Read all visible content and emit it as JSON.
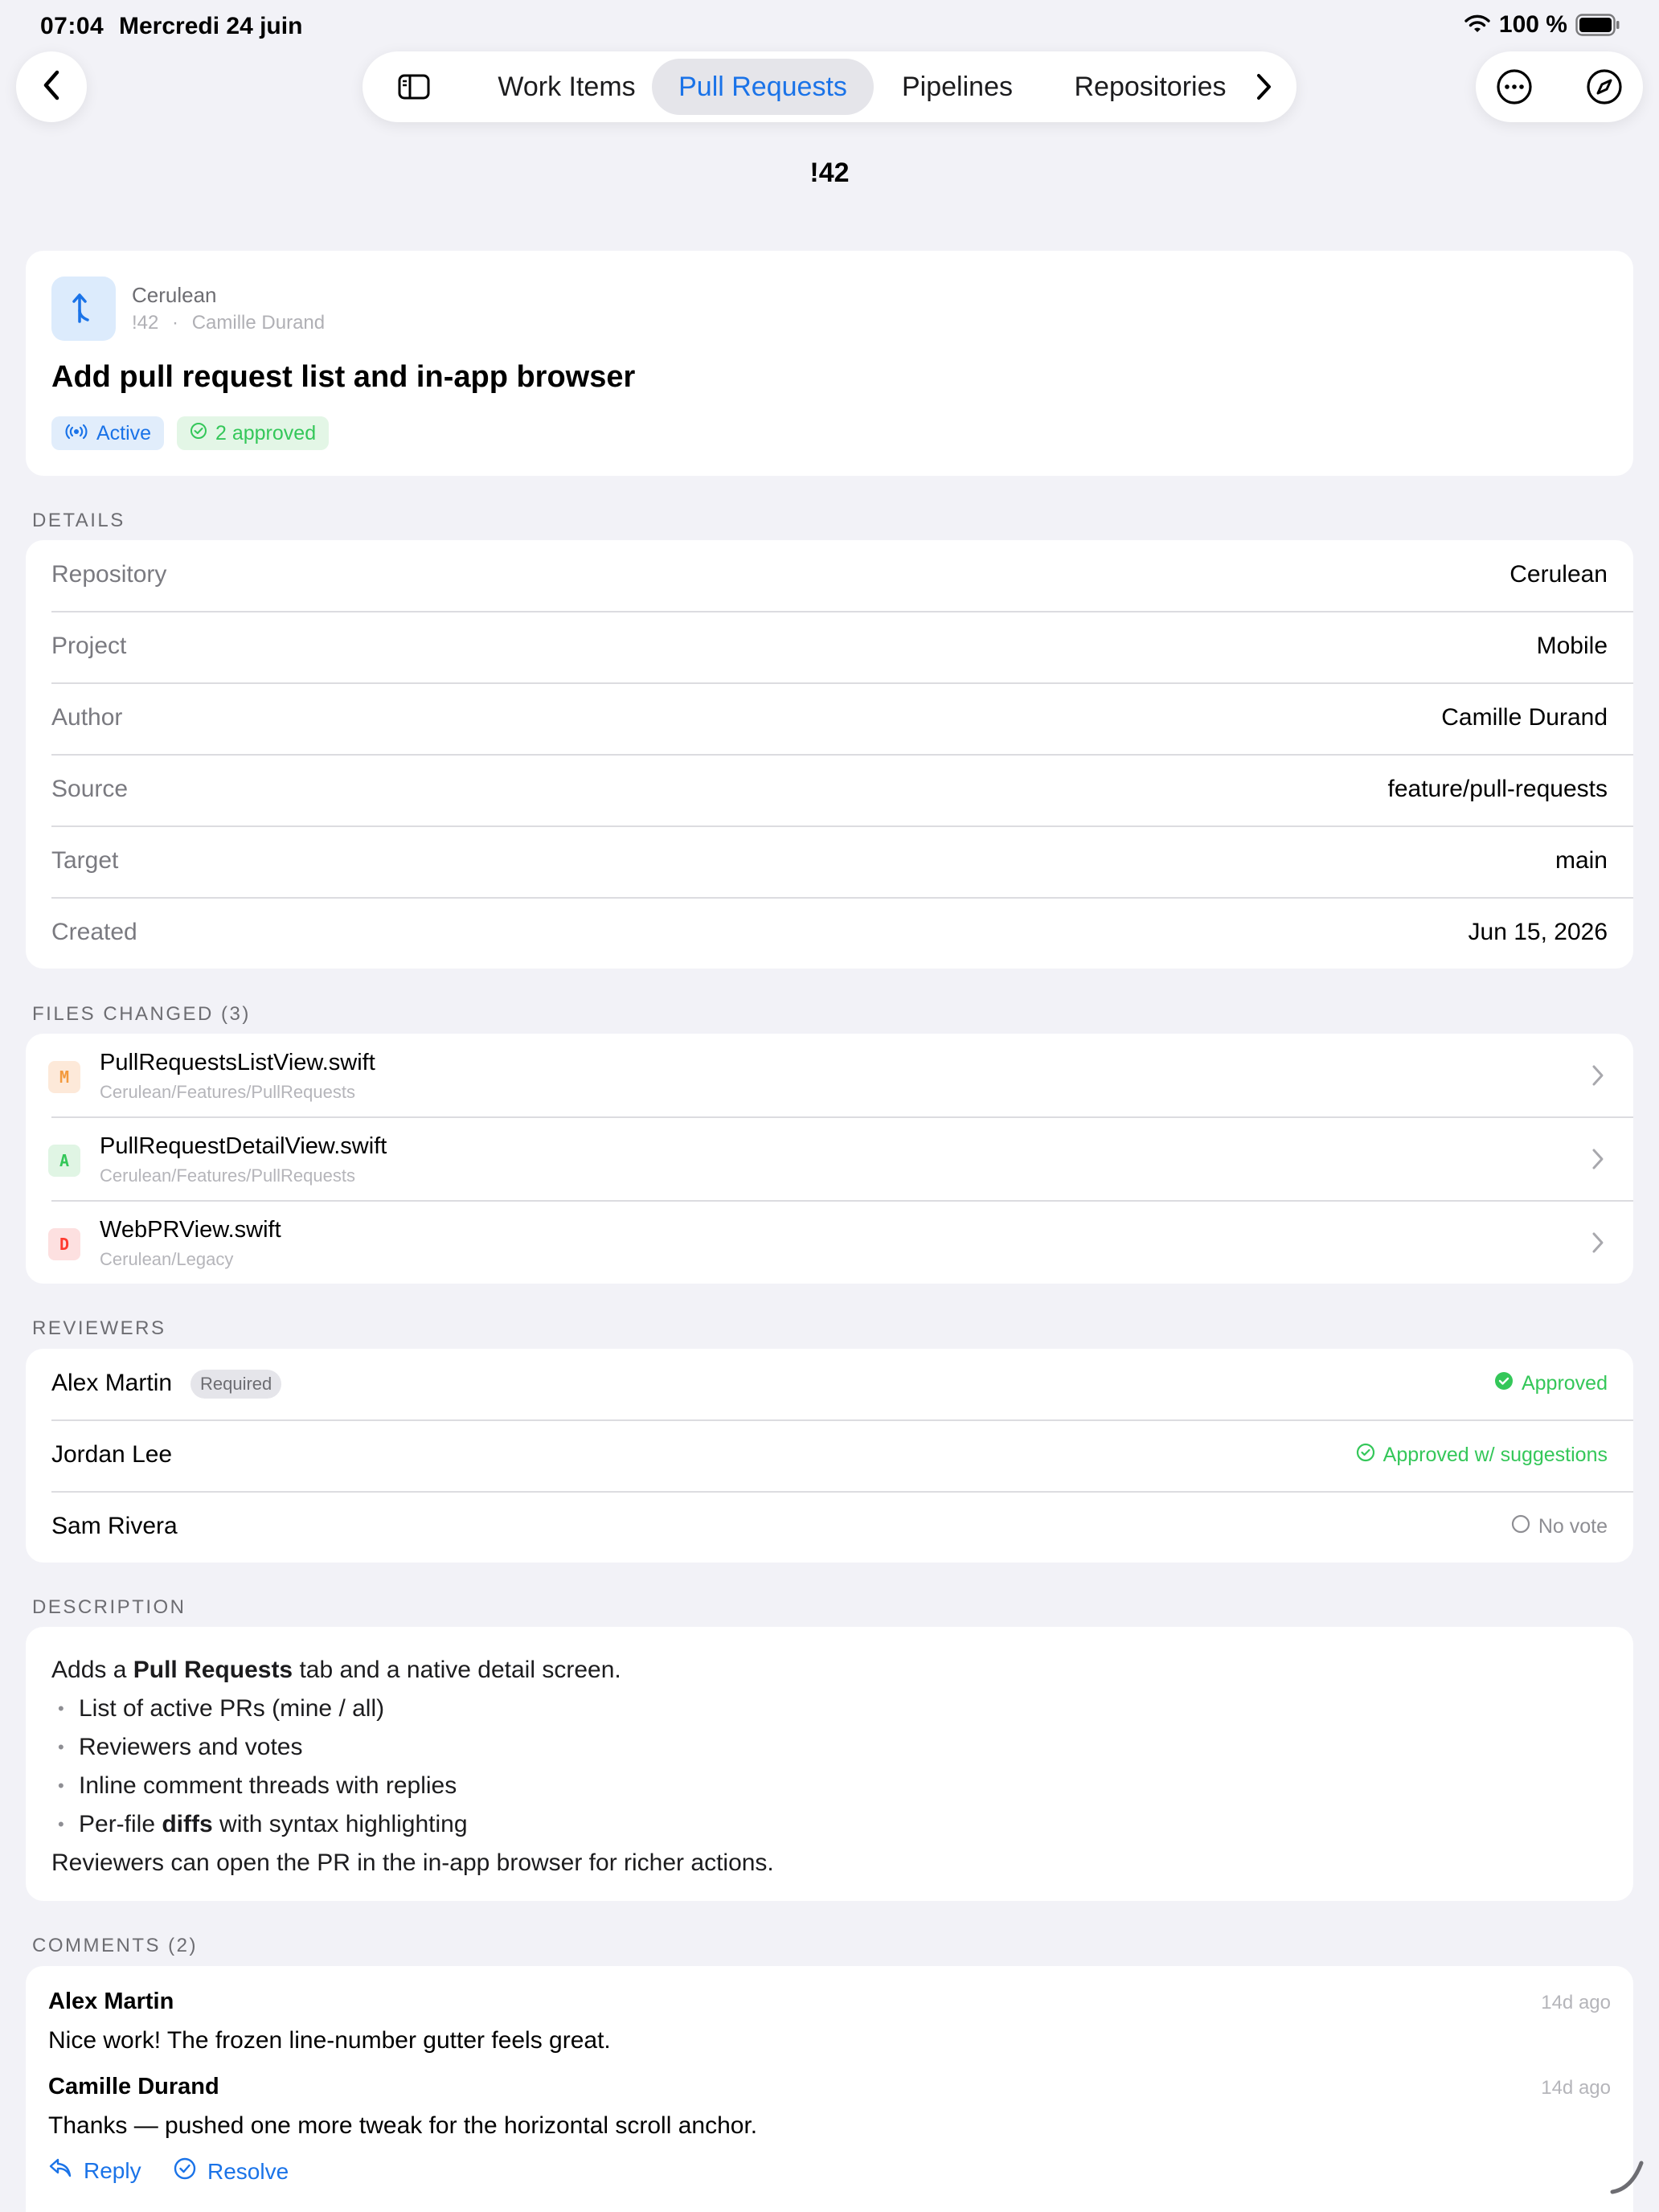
{
  "status_bar": {
    "time": "07:04",
    "date": "Mercredi 24 juin",
    "battery": "100 %"
  },
  "toolbar": {
    "tabs": [
      {
        "label": "Work Items"
      },
      {
        "label": "Pull Requests",
        "active": true
      },
      {
        "label": "Pipelines"
      },
      {
        "label": "Repositories"
      }
    ]
  },
  "nav": {
    "title": "!42"
  },
  "header": {
    "repo": "Cerulean",
    "pr_id": "!42",
    "separator": "·",
    "author": "Camille Durand",
    "title": "Add pull request list and in-app browser",
    "status_badge": "Active",
    "approved_badge": "2 approved"
  },
  "details": {
    "section_title": "DETAILS",
    "rows": [
      {
        "label": "Repository",
        "value": "Cerulean"
      },
      {
        "label": "Project",
        "value": "Mobile"
      },
      {
        "label": "Author",
        "value": "Camille Durand"
      },
      {
        "label": "Source",
        "value": "feature/pull-requests"
      },
      {
        "label": "Target",
        "value": "main"
      },
      {
        "label": "Created",
        "value": "Jun 15, 2026"
      }
    ]
  },
  "files": {
    "section_title": "FILES CHANGED (3)",
    "items": [
      {
        "change": "M",
        "name": "PullRequestsListView.swift",
        "path": "Cerulean/Features/PullRequests"
      },
      {
        "change": "A",
        "name": "PullRequestDetailView.swift",
        "path": "Cerulean/Features/PullRequests"
      },
      {
        "change": "D",
        "name": "WebPRView.swift",
        "path": "Cerulean/Legacy"
      }
    ]
  },
  "reviewers": {
    "section_title": "REVIEWERS",
    "items": [
      {
        "name": "Alex Martin",
        "tag": "Required",
        "vote": "Approved"
      },
      {
        "name": "Jordan Lee",
        "vote": "Approved w/ suggestions"
      },
      {
        "name": "Sam Rivera",
        "vote": "No vote"
      }
    ]
  },
  "description": {
    "section_title": "DESCRIPTION",
    "intro_pre": "Adds a ",
    "intro_bold": "Pull Requests",
    "intro_post": " tab and a native detail screen.",
    "bullets": [
      "List of active PRs (mine / all)",
      "Reviewers and votes",
      "Inline comment threads with replies"
    ],
    "bullet4_pre": "Per-file ",
    "bullet4_bold": "diffs",
    "bullet4_post": " with syntax highlighting",
    "outro": "Reviewers can open the PR in the in-app browser for richer actions."
  },
  "comments": {
    "section_title": "COMMENTS (2)",
    "items": [
      {
        "author": "Alex Martin",
        "time": "14d ago",
        "text": "Nice work! The frozen line-number gutter feels great."
      },
      {
        "author": "Camille Durand",
        "time": "14d ago",
        "text": "Thanks — pushed one more tweak for the horizontal scroll anchor."
      }
    ],
    "reply_label": "Reply",
    "resolve_label": "Resolve"
  },
  "colors": {
    "accent": "#1a73e8",
    "success": "#34c759",
    "background": "#f2f2f7"
  }
}
